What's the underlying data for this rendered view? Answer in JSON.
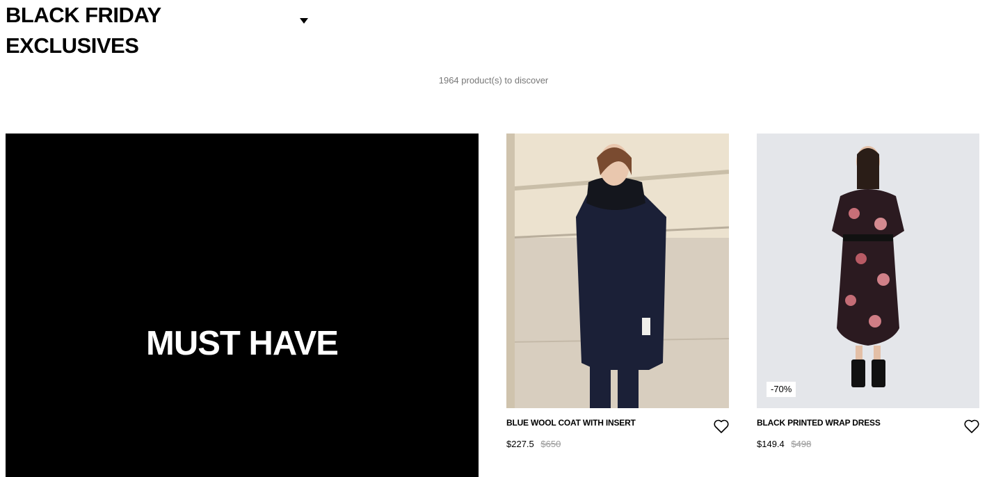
{
  "header": {
    "title_line1": "BLACK FRIDAY",
    "title_line2": "EXCLUSIVES",
    "dropdown_icon": "caret-down-icon"
  },
  "listing": {
    "product_count": "1964 product(s) to discover"
  },
  "promo": {
    "text": "MUST HAVE",
    "background": "#000000"
  },
  "products": [
    {
      "name": "BLUE WOOL COAT WITH INSERT",
      "price": "$227.5",
      "old_price": "$650",
      "badge": "",
      "wishlist_icon": "heart-outline-icon"
    },
    {
      "name": "BLACK PRINTED WRAP DRESS",
      "price": "$149.4",
      "old_price": "$498",
      "badge": "-70%",
      "wishlist_icon": "heart-outline-icon"
    }
  ]
}
